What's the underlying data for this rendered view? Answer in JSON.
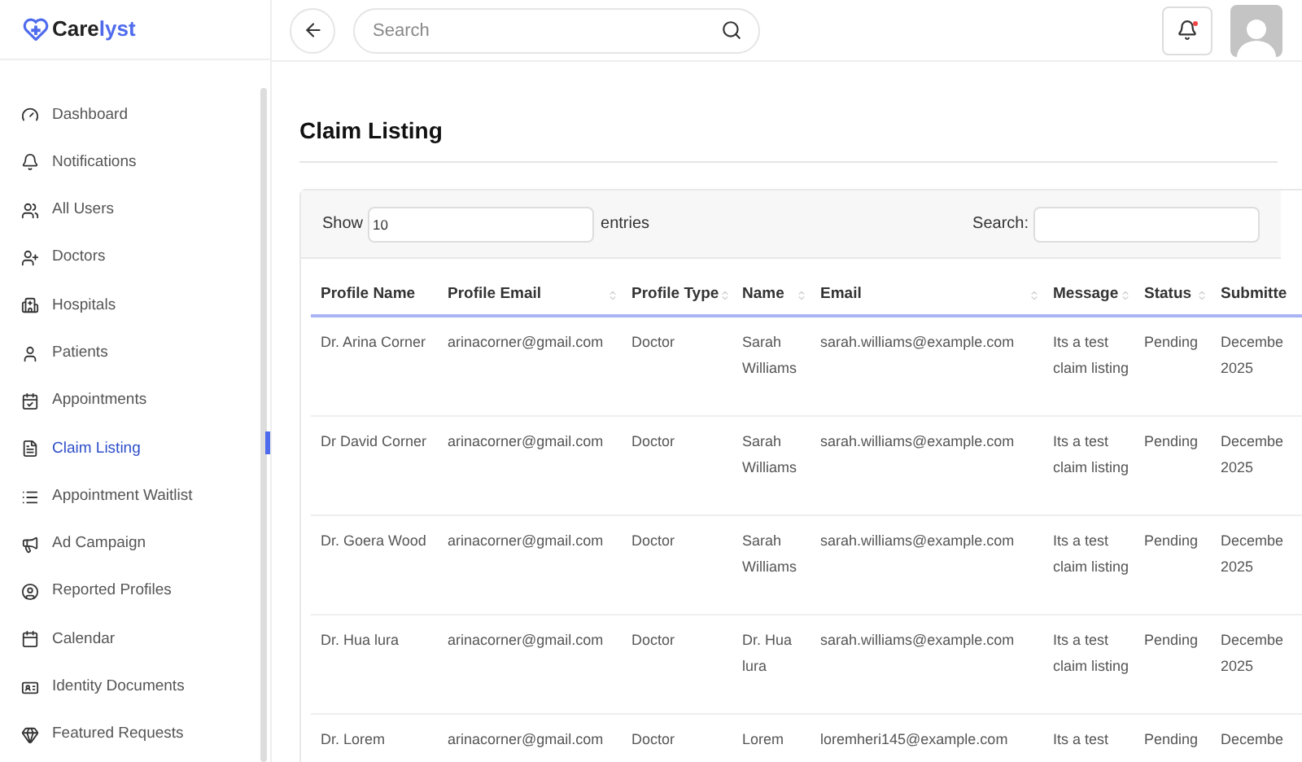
{
  "logo": {
    "text_a": "Care",
    "text_b": "lyst"
  },
  "search": {
    "placeholder": "Search"
  },
  "notifications": {
    "unread": true
  },
  "sidebar": {
    "items": [
      {
        "label": "Dashboard",
        "selected": false
      },
      {
        "label": "Notifications",
        "selected": false
      },
      {
        "label": "All Users",
        "selected": false
      },
      {
        "label": "Doctors",
        "selected": false
      },
      {
        "label": "Hospitals",
        "selected": false
      },
      {
        "label": "Patients",
        "selected": false
      },
      {
        "label": "Appointments",
        "selected": false
      },
      {
        "label": "Claim Listing",
        "selected": true
      },
      {
        "label": "Appointment Waitlist",
        "selected": false
      },
      {
        "label": "Ad Campaign",
        "selected": false
      },
      {
        "label": "Reported Profiles",
        "selected": false
      },
      {
        "label": "Calendar",
        "selected": false
      },
      {
        "label": "Identity Documents",
        "selected": false
      },
      {
        "label": "Featured Requests",
        "selected": false
      }
    ]
  },
  "page_title": "Claim Listing",
  "table_controls": {
    "show_label": "Show",
    "page_size": "10",
    "entries_label": "entries",
    "search_label": "Search:"
  },
  "table": {
    "columns": [
      {
        "label": "Profile Name",
        "sortable": false
      },
      {
        "label": "Profile Email",
        "sortable": true
      },
      {
        "label": "Profile Type",
        "sortable": true
      },
      {
        "label": "Name",
        "sortable": true
      },
      {
        "label": "Email",
        "sortable": true
      },
      {
        "label": "Message",
        "sortable": true
      },
      {
        "label": "Status",
        "sortable": true
      },
      {
        "label": "Submitte",
        "sortable": false
      }
    ],
    "rows": [
      [
        "Dr. Arina Corner",
        "arinacorner@gmail.com",
        "Doctor",
        "Sarah Williams",
        "sarah.williams@example.com",
        "Its a test claim listing",
        "Pending",
        "Decembe 2025"
      ],
      [
        "Dr David Corner",
        "arinacorner@gmail.com",
        "Doctor",
        "Sarah Williams",
        "sarah.williams@example.com",
        "Its a test claim listing",
        "Pending",
        "Decembe 2025"
      ],
      [
        "Dr. Goera Wood",
        "arinacorner@gmail.com",
        "Doctor",
        "Sarah Williams",
        "sarah.williams@example.com",
        "Its a test claim listing",
        "Pending",
        "Decembe 2025"
      ],
      [
        "Dr. Hua lura",
        "arinacorner@gmail.com",
        "Doctor",
        "Dr. Hua lura",
        "sarah.williams@example.com",
        "Its a test claim listing",
        "Pending",
        "Decembe 2025"
      ],
      [
        "Dr. Lorem",
        "arinacorner@gmail.com",
        "Doctor",
        "Lorem",
        "loremheri145@example.com",
        "Its a test",
        "Pending",
        "Decembe"
      ]
    ]
  }
}
